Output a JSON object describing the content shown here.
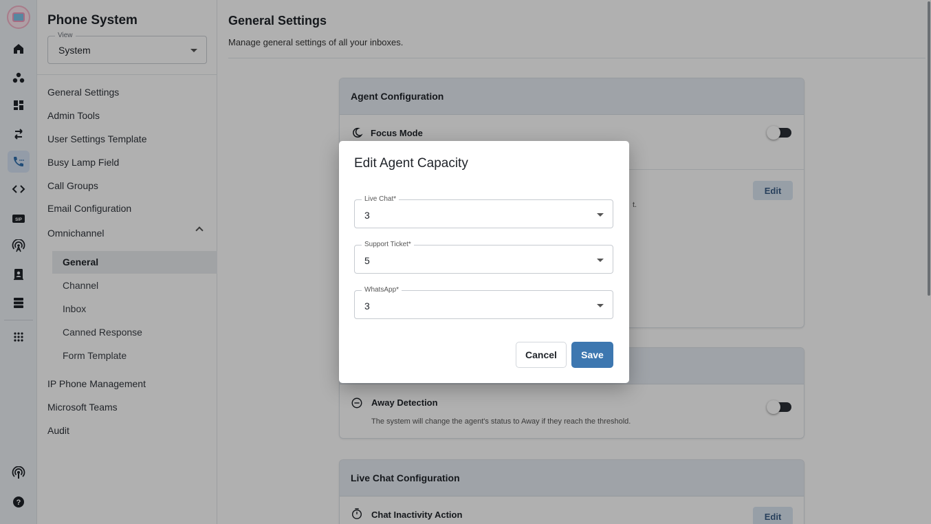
{
  "rail": {
    "icons": [
      "app-logo",
      "home-icon",
      "people-group-icon",
      "dashboard-icon",
      "transfer-arrows-icon",
      "phone-system-icon",
      "code-icon",
      "sip-icon",
      "antenna-icon",
      "contacts-icon",
      "storage-icon",
      "apps-grid-icon",
      "broadcast-icon",
      "help-icon"
    ],
    "sip_label": "SIP",
    "active": "phone-system-icon"
  },
  "sidebar": {
    "title": "Phone System",
    "view": {
      "legend": "View",
      "value": "System"
    },
    "items": [
      {
        "label": "General Settings"
      },
      {
        "label": "Admin Tools"
      },
      {
        "label": "User Settings Template"
      },
      {
        "label": "Busy Lamp Field"
      },
      {
        "label": "Call Groups"
      },
      {
        "label": "Email Configuration"
      },
      {
        "label": "Omnichannel",
        "expanded": true
      }
    ],
    "sub_items": [
      {
        "label": "General",
        "active": true
      },
      {
        "label": "Channel"
      },
      {
        "label": "Inbox"
      },
      {
        "label": "Canned Response"
      },
      {
        "label": "Form Template"
      }
    ],
    "items_after": [
      {
        "label": "IP Phone Management"
      },
      {
        "label": "Microsoft Teams"
      },
      {
        "label": "Audit"
      }
    ]
  },
  "main": {
    "title": "General Settings",
    "subtitle": "Manage general settings of all your inboxes.",
    "cards": {
      "agent": {
        "header": "Agent Configuration",
        "focus_mode": {
          "title": "Focus Mode",
          "toggle_on": false
        },
        "capacity_edit_label": "Edit",
        "clipped_text": "t."
      },
      "away": {
        "title": "Away Detection",
        "desc": "The system will change the agent's status to Away if they reach the threshold.",
        "toggle_on": false
      },
      "live_chat": {
        "header": "Live Chat Configuration",
        "inactivity": {
          "title": "Chat Inactivity Action",
          "edit_label": "Edit"
        }
      }
    }
  },
  "modal": {
    "title": "Edit Agent Capacity",
    "fields": [
      {
        "legend": "Live Chat*",
        "value": "3"
      },
      {
        "legend": "Support Ticket*",
        "value": "5"
      },
      {
        "legend": "WhatsApp*",
        "value": "3"
      }
    ],
    "cancel_label": "Cancel",
    "save_label": "Save"
  },
  "colors": {
    "primary": "#3d77b0",
    "card_header": "#e6ecf3",
    "rail_bg": "#eef2f7"
  }
}
